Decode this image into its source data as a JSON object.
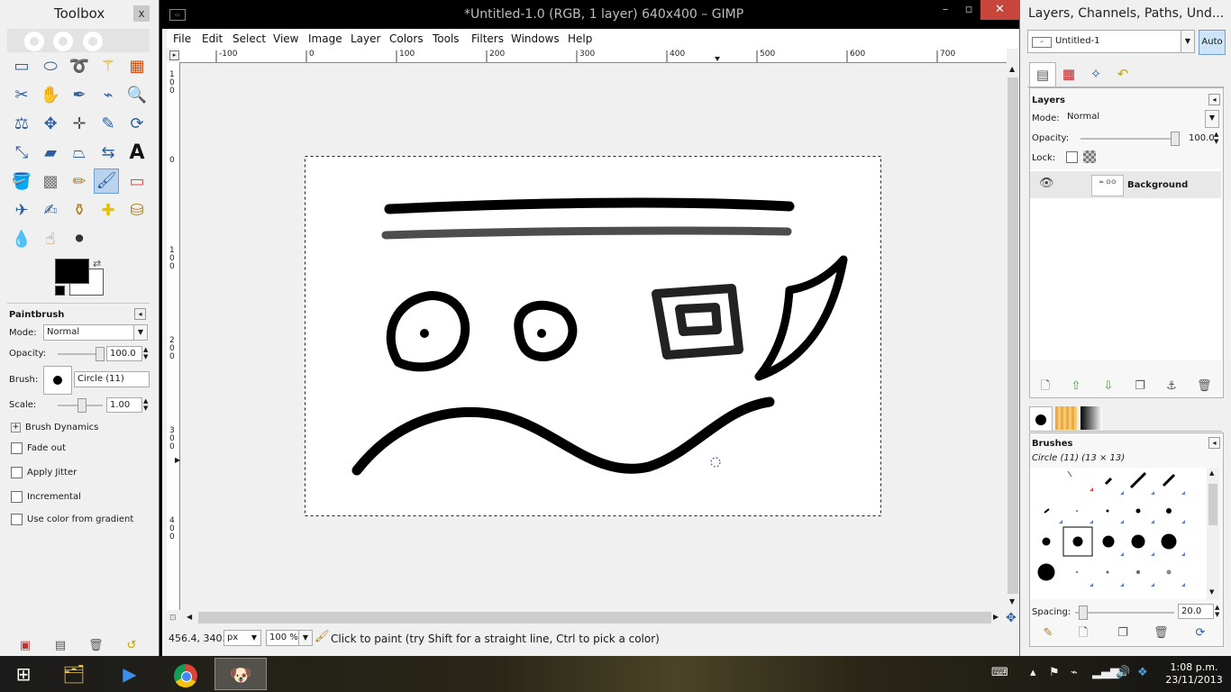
{
  "toolbox": {
    "title": "Toolbox",
    "close": "x",
    "tool_options": {
      "title": "Paintbrush",
      "mode_label": "Mode:",
      "mode_value": "Normal",
      "opacity_label": "Opacity:",
      "opacity_value": "100.0",
      "opacity_fraction": 1.0,
      "brush_label": "Brush:",
      "brush_value": "Circle (11)",
      "scale_label": "Scale:",
      "scale_value": "1.00",
      "brush_dynamics": "Brush Dynamics",
      "fade_out": "Fade out",
      "apply_jitter": "Apply Jitter",
      "incremental": "Incremental",
      "use_color_gradient": "Use color from gradient"
    },
    "colors": {
      "foreground": "#000000",
      "background": "#ffffff"
    }
  },
  "main": {
    "title": "*Untitled-1.0 (RGB, 1 layer) 640x400 – GIMP",
    "menus": [
      "File",
      "Edit",
      "Select",
      "View",
      "Image",
      "Layer",
      "Colors",
      "Tools",
      "Filters",
      "Windows",
      "Help"
    ],
    "hruler_ticks": [
      "-100",
      "0",
      "100",
      "200",
      "300",
      "400",
      "500",
      "600",
      "700"
    ],
    "vruler_ticks": [
      "1\n0\n0",
      "0",
      "1\n0\n0",
      "2\n0\n0",
      "3\n0\n0",
      "4\n0\n0"
    ],
    "status": {
      "coords": "456.4, 340.3",
      "unit": "px",
      "zoom": "100 %",
      "message": "Click to paint (try Shift for a straight line, Ctrl to pick a color)"
    }
  },
  "dock": {
    "title": "Layers, Channels, Paths, Und...",
    "image_select": "Untitled-1",
    "auto_button": "Auto",
    "layers": {
      "title": "Layers",
      "mode_label": "Mode:",
      "mode_value": "Normal",
      "opacity_label": "Opacity:",
      "opacity_value": "100.0",
      "opacity_fraction": 1.0,
      "lock_label": "Lock:",
      "items": [
        {
          "name": "Background"
        }
      ]
    },
    "brushes": {
      "title": "Brushes",
      "current": "Circle (11) (13 × 13)",
      "spacing_label": "Spacing:",
      "spacing_value": "20.0"
    }
  },
  "taskbar": {
    "time": "1:08 p.m.",
    "date": "23/11/2013"
  }
}
